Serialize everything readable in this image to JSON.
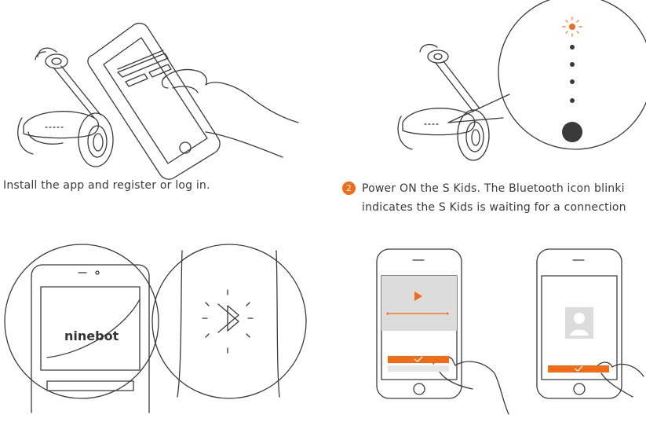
{
  "step1": {
    "caption": "Install the app and register or log in."
  },
  "step2": {
    "number": "2",
    "caption_line1": "Power ON the S Kids. The Bluetooth icon blinki",
    "caption_line2": "indicates the S Kids is waiting for a connection"
  },
  "step3": {
    "brand_text": "ninebot"
  },
  "colors": {
    "accent": "#f26b16",
    "line": "#3a3a3a",
    "screen_gray": "#dcdcdc"
  }
}
